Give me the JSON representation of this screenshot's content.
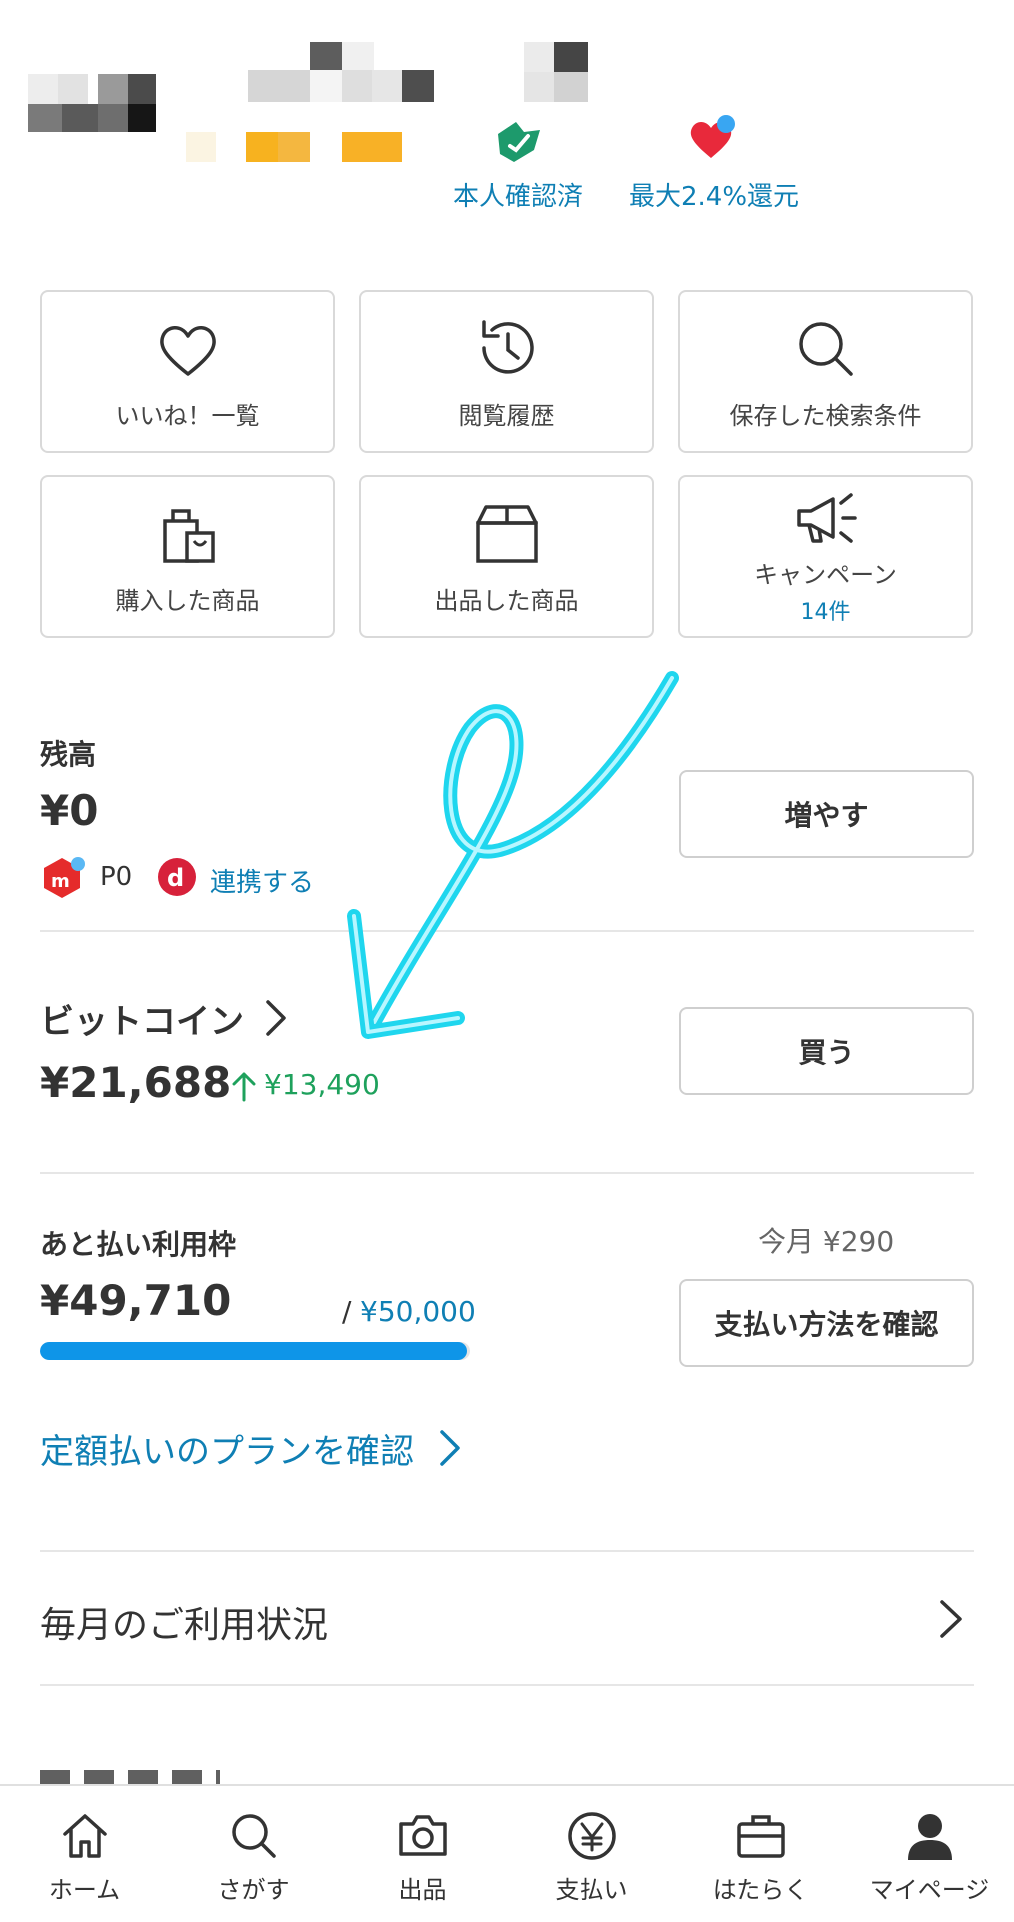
{
  "profile": {
    "badges": [
      {
        "label": "本人確認済",
        "icon": "verified-shield-icon"
      },
      {
        "label": "最大2.4%還元",
        "icon": "heart-icon"
      }
    ]
  },
  "quick_links": [
    {
      "label": "いいね！一覧",
      "icon": "heart-outline-icon"
    },
    {
      "label": "閲覧履歴",
      "icon": "history-icon"
    },
    {
      "label": "保存した検索条件",
      "icon": "search-icon"
    },
    {
      "label": "購入した商品",
      "icon": "shopping-bag-icon"
    },
    {
      "label": "出品した商品",
      "icon": "box-icon"
    },
    {
      "label": "キャンペーン",
      "count": "14件",
      "icon": "megaphone-icon"
    }
  ],
  "balance": {
    "title": "残高",
    "amount": "¥0",
    "points": "P0",
    "link_label": "連携する",
    "button": "増やす"
  },
  "bitcoin": {
    "title": "ビットコイン",
    "amount": "¥21,688",
    "change": "¥13,490",
    "button": "買う"
  },
  "deferred_payment": {
    "title": "あと払い利用枠",
    "this_month": "今月 ¥290",
    "available": "¥49,710",
    "limit_prefix": "/",
    "limit": "¥50,000",
    "usage_fraction": 0.994,
    "button": "支払い方法を確認",
    "plan_link": "定額払いのプランを確認"
  },
  "monthly_usage": {
    "label": "毎月のご利用状況"
  },
  "bottom_nav": [
    {
      "label": "ホーム",
      "icon": "home-icon"
    },
    {
      "label": "さがす",
      "icon": "search-icon"
    },
    {
      "label": "出品",
      "icon": "camera-icon"
    },
    {
      "label": "支払い",
      "icon": "yen-icon"
    },
    {
      "label": "はたらく",
      "icon": "briefcase-icon"
    },
    {
      "label": "マイページ",
      "icon": "person-icon"
    }
  ],
  "colors": {
    "accent": "#0f7fb4",
    "progress": "#0e95e8",
    "gain": "#1ea15c",
    "annotation": "#1fd6ee"
  }
}
